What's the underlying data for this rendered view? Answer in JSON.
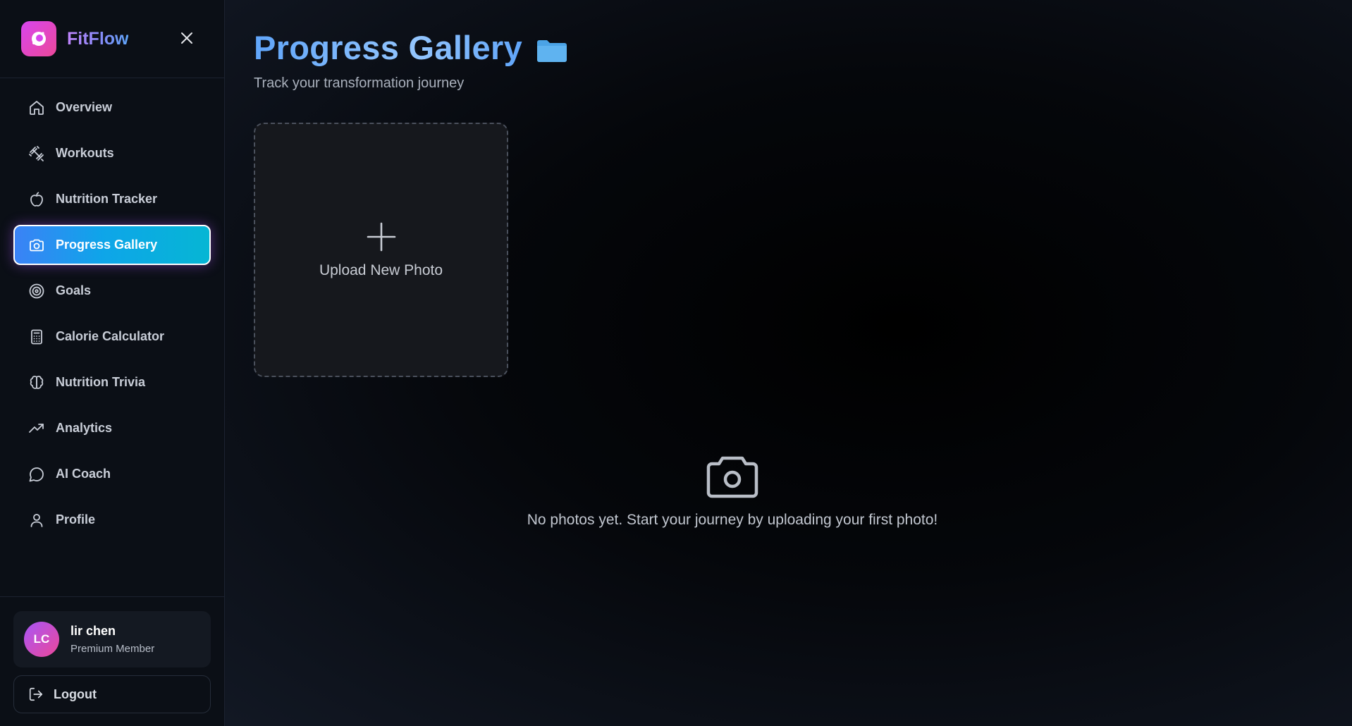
{
  "brand": {
    "name": "FitFlow"
  },
  "nav": {
    "items": [
      {
        "label": "Overview",
        "icon": "home-icon"
      },
      {
        "label": "Workouts",
        "icon": "dumbbell-icon"
      },
      {
        "label": "Nutrition Tracker",
        "icon": "apple-icon"
      },
      {
        "label": "Progress Gallery",
        "icon": "camera-icon",
        "active": true
      },
      {
        "label": "Goals",
        "icon": "target-icon"
      },
      {
        "label": "Calorie Calculator",
        "icon": "calculator-icon"
      },
      {
        "label": "Nutrition Trivia",
        "icon": "brain-icon"
      },
      {
        "label": "Analytics",
        "icon": "trending-up-icon"
      },
      {
        "label": "AI Coach",
        "icon": "chat-bubble-icon"
      },
      {
        "label": "Profile",
        "icon": "user-icon"
      }
    ]
  },
  "user": {
    "initials": "LC",
    "name": "lir chen",
    "role": "Premium Member"
  },
  "logout": {
    "label": "Logout"
  },
  "page": {
    "title": "Progress Gallery",
    "subtitle": "Track your transformation journey",
    "upload_label": "Upload New Photo",
    "empty_message": "No photos yet. Start your journey by uploading your first photo!"
  },
  "colors": {
    "accent_start": "#3b82f6",
    "accent_end": "#06b6d4",
    "brand_gradient": "#d946ef",
    "title_blue": "#60a5fa"
  }
}
